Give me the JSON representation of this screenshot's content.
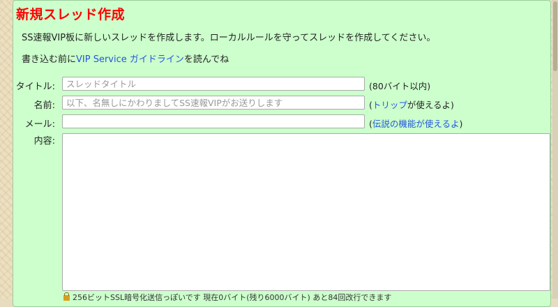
{
  "form": {
    "title": "新規スレッド作成",
    "intro_line1": "SS速報VIP板に新しいスレッドを作成します。ローカルルールを守ってスレッドを作成してください。",
    "intro_line2_prefix": "書き込む前に",
    "intro_link": "VIP Service ガイドライン",
    "intro_line2_suffix": "を読んでね",
    "title_label": "タイトル:",
    "title_placeholder": "スレッドタイトル",
    "title_hint": "(80バイト以内)",
    "name_label": "名前:",
    "name_placeholder": "以下、名無しにかわりましてSS速報VIPがお送りします",
    "name_hint_open": "(",
    "name_hint_link": "トリップ",
    "name_hint_rest": "が使えるよ)",
    "mail_label": "メール:",
    "mail_value": "",
    "mail_hint_open": "(",
    "mail_hint_link": "伝説の機能が使えるよ",
    "mail_hint_close": ")",
    "content_label": "内容:",
    "content_value": "",
    "footer_note": "256ビットSSL暗号化送信っぽいです 現在0バイト(残り6000バイト) あと84回改行できます"
  }
}
